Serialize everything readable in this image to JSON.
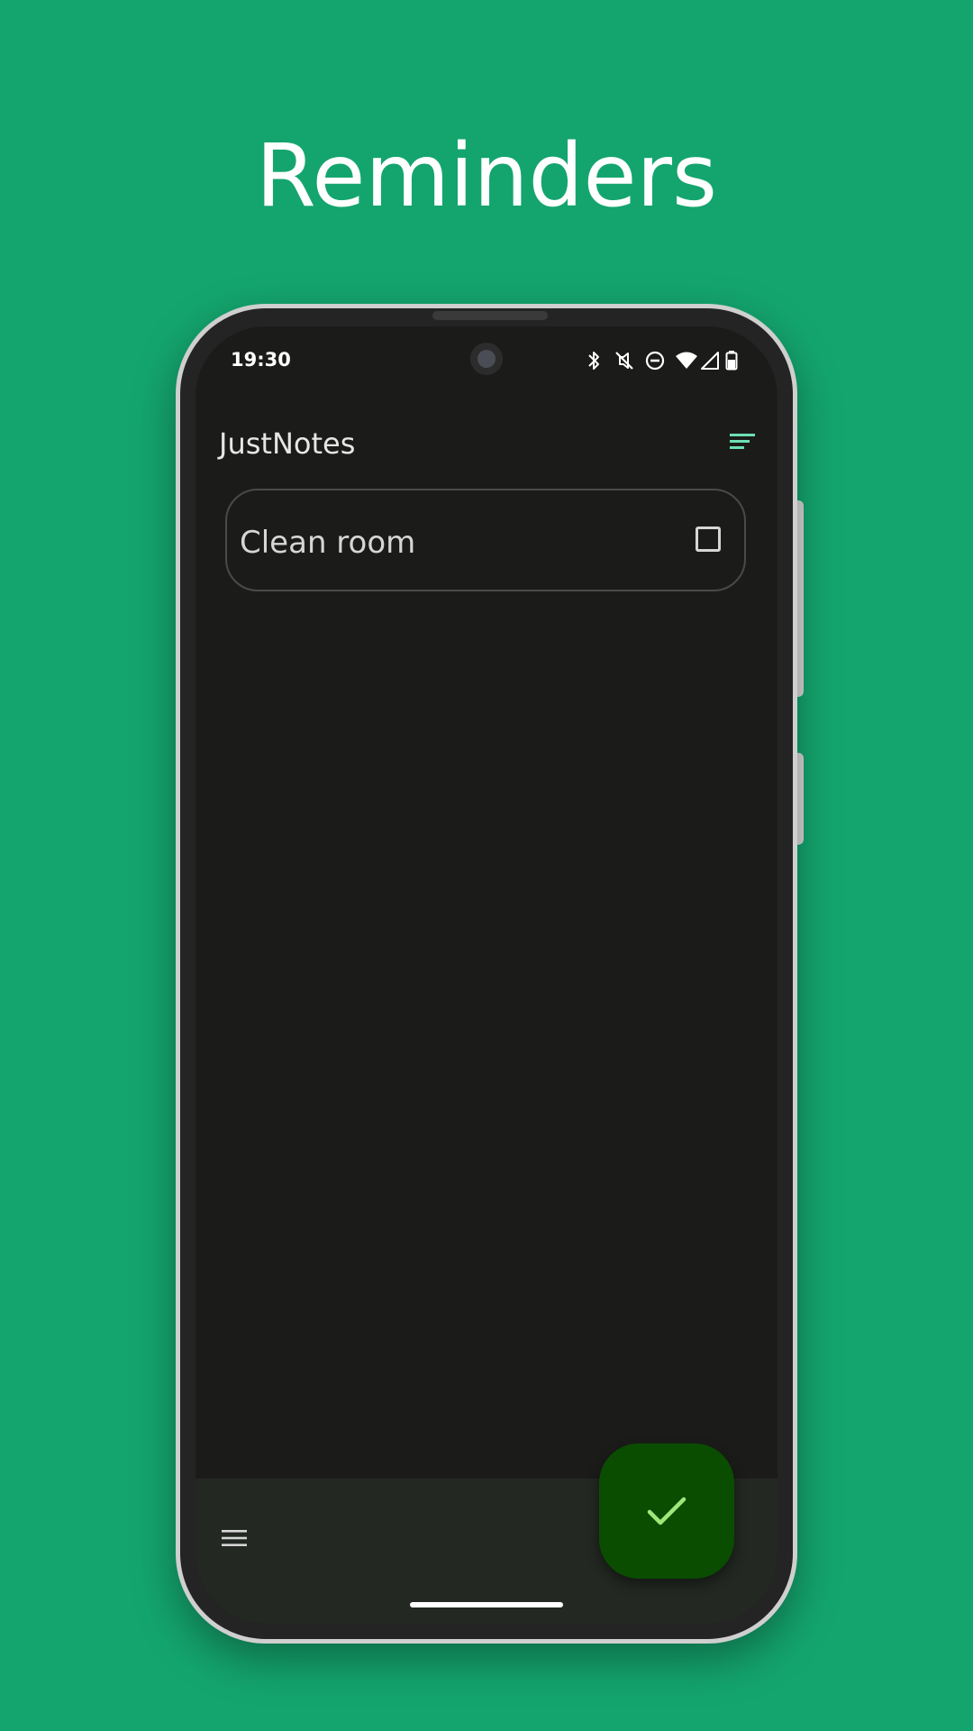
{
  "promo": {
    "headline": "Reminders"
  },
  "status_bar": {
    "time": "19:30",
    "icons": [
      "bluetooth-icon",
      "muted-icon",
      "do-not-disturb-icon",
      "wifi-icon",
      "signal-icon",
      "battery-icon"
    ]
  },
  "app_bar": {
    "title": "JustNotes",
    "sort_icon": "sort-icon"
  },
  "notes": [
    {
      "text": "Clean room",
      "checked": false
    }
  ],
  "bottom_bar": {
    "menu_icon": "menu-icon"
  },
  "fab": {
    "icon": "check-icon"
  },
  "colors": {
    "background": "#14a56e",
    "screen": "#1b1c1a",
    "accent": "#6ee0b4",
    "fab": "#0a4d00",
    "fab_icon": "#9ee87a",
    "bottom_bar": "#232822"
  }
}
